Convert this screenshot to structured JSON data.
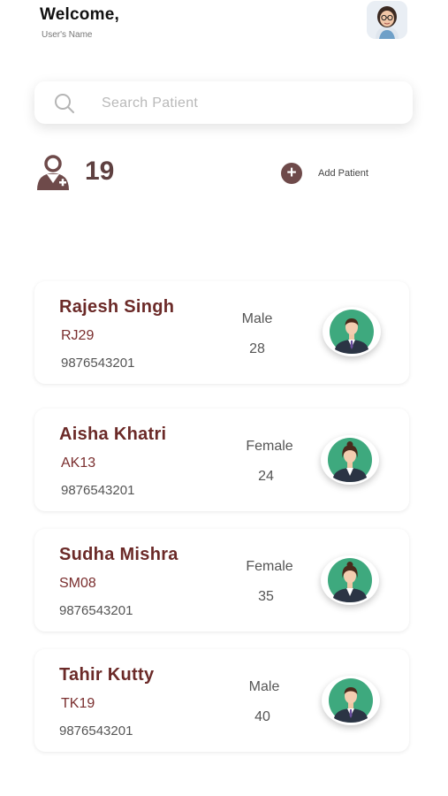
{
  "header": {
    "welcome": "Welcome,",
    "username": "User's Name",
    "avatar_icon": "profile-photo-icon"
  },
  "search": {
    "placeholder": "Search Patient",
    "value": "",
    "icon": "search-icon"
  },
  "summary": {
    "patient_count": "19",
    "icon": "doctor-user-icon",
    "add_label": "Add Patient",
    "add_icon": "plus-icon"
  },
  "colors": {
    "brand": "#6b2a28",
    "accent": "#6e4a4a",
    "avatar_bg": "#3ea97e"
  },
  "patients": [
    {
      "name": "Rajesh Singh",
      "id": "RJ29",
      "phone": "9876543201",
      "gender": "Male",
      "age": "28",
      "avatar_icon": "male-avatar-icon"
    },
    {
      "name": "Aisha Khatri",
      "id": "AK13",
      "phone": "9876543201",
      "gender": "Female",
      "age": "24",
      "avatar_icon": "female-avatar-icon"
    },
    {
      "name": "Sudha Mishra",
      "id": "SM08",
      "phone": "9876543201",
      "gender": "Female",
      "age": "35",
      "avatar_icon": "female-avatar-icon"
    },
    {
      "name": "Tahir Kutty",
      "id": "TK19",
      "phone": "9876543201",
      "gender": "Male",
      "age": "40",
      "avatar_icon": "male-avatar-icon"
    }
  ]
}
